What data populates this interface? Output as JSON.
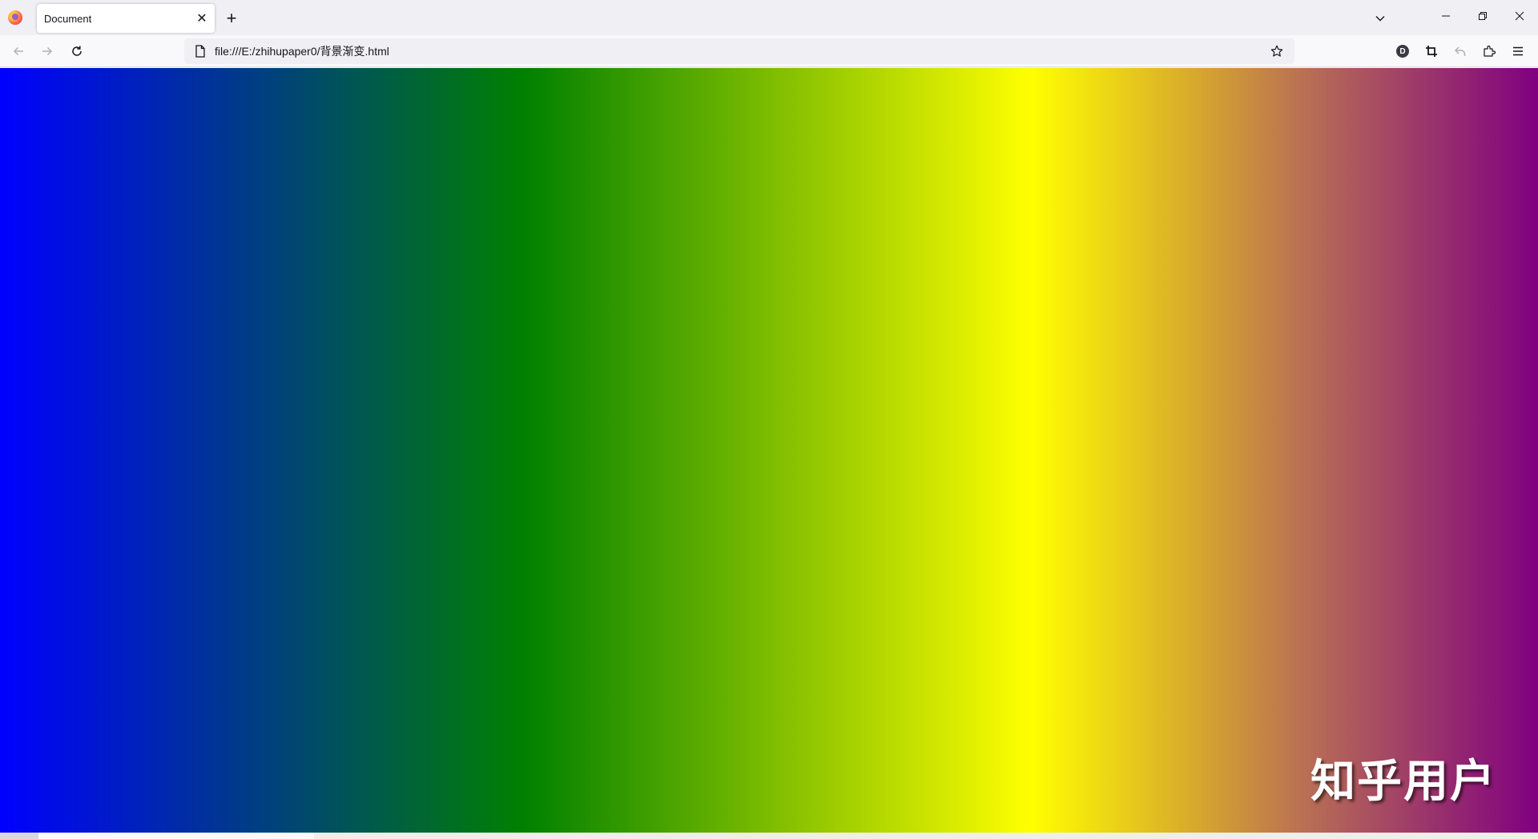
{
  "browser": {
    "tab": {
      "title": "Document",
      "close_glyph": "✕"
    },
    "new_tab_glyph": "+",
    "url": "file:///E:/zhihupaper0/背景渐变.html",
    "toolbar_badge": "D"
  },
  "page": {
    "gradient_colors": [
      "#0000ff",
      "#004a6a",
      "#008000",
      "#7cbc00",
      "#ffff00",
      "#d6a62e",
      "#b86e55",
      "#800080"
    ],
    "watermark": "知乎用户"
  },
  "icons": {
    "browser_logo": "firefox-logo-icon",
    "list_tabs": "chevron-down-icon",
    "minimize": "minimize-icon",
    "restore": "restore-icon",
    "close": "close-icon",
    "back": "back-arrow-icon",
    "forward": "forward-arrow-icon",
    "reload": "reload-icon",
    "page": "page-icon",
    "bookmark": "star-icon",
    "crop": "crop-icon",
    "undo": "undo-icon",
    "extensions": "extensions-icon",
    "menu": "hamburger-menu-icon"
  }
}
